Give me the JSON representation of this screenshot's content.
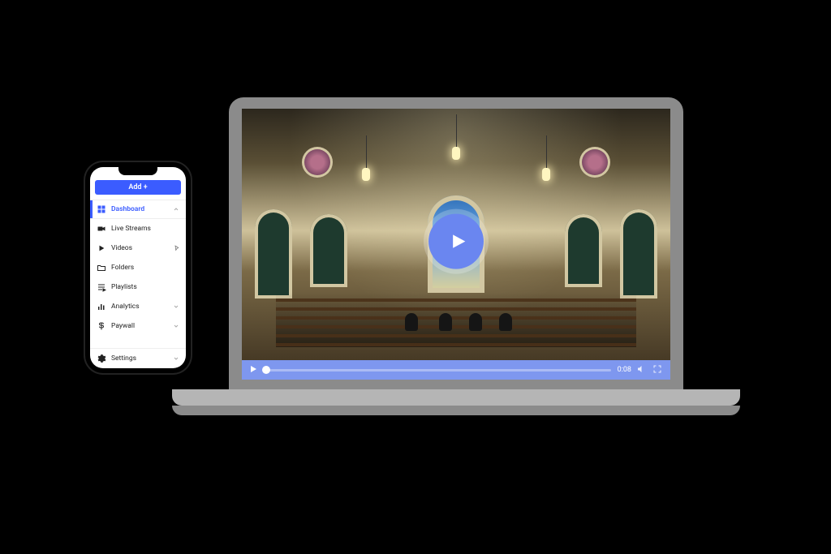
{
  "phone": {
    "add_label": "Add +",
    "nav": {
      "dashboard": {
        "label": "Dashboard"
      },
      "live": {
        "label": "Live Streams"
      },
      "videos": {
        "label": "Videos"
      },
      "folders": {
        "label": "Folders"
      },
      "playlists": {
        "label": "Playlists"
      },
      "analytics": {
        "label": "Analytics"
      },
      "paywall": {
        "label": "Paywall"
      },
      "settings": {
        "label": "Settings"
      }
    }
  },
  "player": {
    "time": "0:08"
  },
  "colors": {
    "accent": "#3b5cff",
    "player_bar": "#7e97ef",
    "play_button": "#6a86f0"
  }
}
